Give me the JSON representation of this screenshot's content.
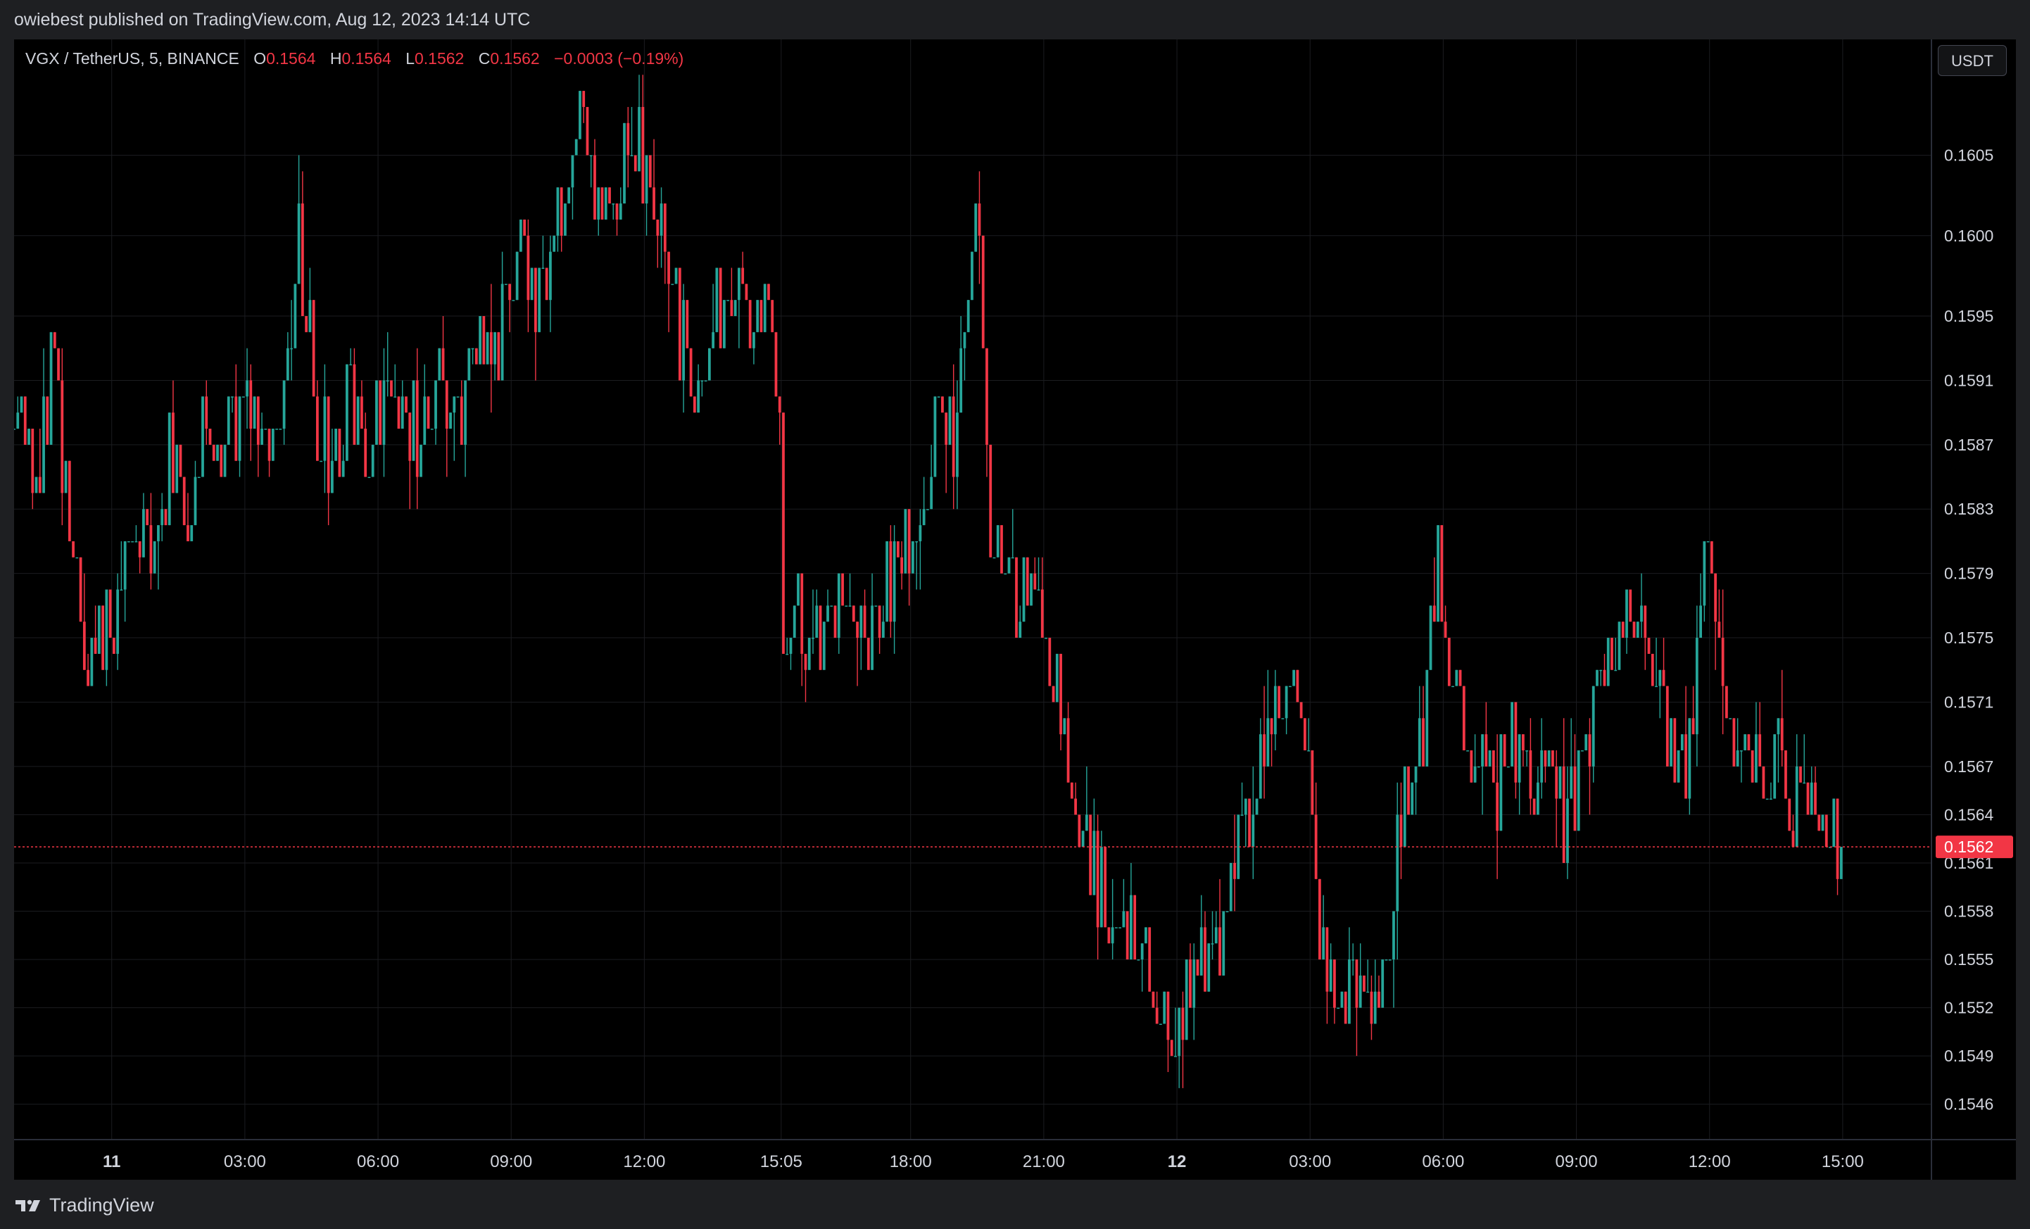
{
  "header": {
    "published": "owiebest published on TradingView.com, Aug 12, 2023 14:14 UTC"
  },
  "symbol": {
    "name": "VGX / TetherUS, 5, BINANCE",
    "o_label": "O",
    "o_value": "0.1564",
    "h_label": "H",
    "h_value": "0.1564",
    "l_label": "L",
    "l_value": "0.1562",
    "c_label": "C",
    "c_value": "0.1562",
    "change": "−0.0003 (−0.19%)"
  },
  "currency_button": "USDT",
  "footer": {
    "brand": "TradingView",
    "logo_icon": "tradingview-logo-icon"
  },
  "colors": {
    "up": "#26a69a",
    "down": "#f23645",
    "price_line": "#f23645",
    "background": "#000000",
    "grid": "#1b1c20"
  },
  "chart_data": {
    "type": "candlestick",
    "title": "",
    "xlabel": "",
    "ylabel": "",
    "ylim": [
      0.15438,
      0.16122
    ],
    "x_ticks": [
      "11",
      "03:00",
      "06:00",
      "09:00",
      "12:00",
      "15:05",
      "18:00",
      "21:00",
      "12",
      "03:00",
      "06:00",
      "09:00",
      "12:00",
      "15:00"
    ],
    "x_tick_hours": [
      0,
      3,
      6,
      9,
      12,
      15.083,
      18,
      21,
      24,
      27,
      30,
      33,
      36,
      39
    ],
    "x_range_hours": [
      -2.2,
      41
    ],
    "y_ticks": [
      "0.1546",
      "0.1549",
      "0.1552",
      "0.1555",
      "0.1558",
      "0.1561",
      "0.1564",
      "0.1567",
      "0.1571",
      "0.1575",
      "0.1579",
      "0.1583",
      "0.1587",
      "0.1591",
      "0.1595",
      "0.1600",
      "0.1605"
    ],
    "last_price": "0.1562",
    "grid": true,
    "path": [
      [
        -2.2,
        0.1588
      ],
      [
        -1.7,
        0.1584
      ],
      [
        -1.3,
        0.1592
      ],
      [
        -0.9,
        0.158
      ],
      [
        -0.5,
        0.1573
      ],
      [
        -0.1,
        0.1577
      ],
      [
        0.3,
        0.1578
      ],
      [
        0.7,
        0.1583
      ],
      [
        1.0,
        0.1581
      ],
      [
        1.3,
        0.1586
      ],
      [
        1.7,
        0.1582
      ],
      [
        2.1,
        0.1589
      ],
      [
        2.5,
        0.1586
      ],
      [
        2.9,
        0.159
      ],
      [
        3.3,
        0.1587
      ],
      [
        3.9,
        0.159
      ],
      [
        4.2,
        0.16
      ],
      [
        4.6,
        0.1589
      ],
      [
        5.0,
        0.1586
      ],
      [
        5.4,
        0.159
      ],
      [
        5.8,
        0.1587
      ],
      [
        6.2,
        0.1591
      ],
      [
        6.6,
        0.1589
      ],
      [
        7.0,
        0.1588
      ],
      [
        7.5,
        0.159
      ],
      [
        7.9,
        0.1589
      ],
      [
        8.3,
        0.1595
      ],
      [
        8.7,
        0.1593
      ],
      [
        9.0,
        0.1596
      ],
      [
        9.3,
        0.1599
      ],
      [
        9.6,
        0.1596
      ],
      [
        9.9,
        0.1601
      ],
      [
        10.2,
        0.1603
      ],
      [
        10.5,
        0.1606
      ],
      [
        10.8,
        0.1604
      ],
      [
        11.1,
        0.1602
      ],
      [
        11.4,
        0.1604
      ],
      [
        11.7,
        0.1607
      ],
      [
        12.0,
        0.1605
      ],
      [
        12.4,
        0.1599
      ],
      [
        12.8,
        0.1594
      ],
      [
        13.2,
        0.1591
      ],
      [
        13.6,
        0.1595
      ],
      [
        13.9,
        0.1594
      ],
      [
        14.2,
        0.1597
      ],
      [
        14.5,
        0.1593
      ],
      [
        14.8,
        0.1595
      ],
      [
        15.05,
        0.1589
      ],
      [
        15.15,
        0.1573
      ],
      [
        15.4,
        0.1577
      ],
      [
        15.8,
        0.1574
      ],
      [
        16.2,
        0.1577
      ],
      [
        16.6,
        0.1575
      ],
      [
        17.0,
        0.1574
      ],
      [
        17.4,
        0.1578
      ],
      [
        17.8,
        0.158
      ],
      [
        18.2,
        0.1583
      ],
      [
        18.6,
        0.1588
      ],
      [
        19.0,
        0.1587
      ],
      [
        19.3,
        0.1596
      ],
      [
        19.55,
        0.1603
      ],
      [
        19.8,
        0.1582
      ],
      [
        20.2,
        0.1578
      ],
      [
        20.6,
        0.1578
      ],
      [
        21.0,
        0.1576
      ],
      [
        21.3,
        0.1573
      ],
      [
        21.6,
        0.1566
      ],
      [
        22.0,
        0.1562
      ],
      [
        22.4,
        0.1558
      ],
      [
        22.8,
        0.1556
      ],
      [
        23.1,
        0.1557
      ],
      [
        23.4,
        0.1554
      ],
      [
        23.8,
        0.155
      ],
      [
        24.2,
        0.1553
      ],
      [
        24.6,
        0.1555
      ],
      [
        25.0,
        0.1557
      ],
      [
        25.4,
        0.1562
      ],
      [
        25.8,
        0.1567
      ],
      [
        26.2,
        0.1572
      ],
      [
        26.6,
        0.1571
      ],
      [
        26.9,
        0.1569
      ],
      [
        27.2,
        0.1558
      ],
      [
        27.6,
        0.1552
      ],
      [
        28.0,
        0.1553
      ],
      [
        28.4,
        0.1552
      ],
      [
        28.7,
        0.1555
      ],
      [
        29.0,
        0.1562
      ],
      [
        29.3,
        0.1567
      ],
      [
        29.6,
        0.157
      ],
      [
        29.9,
        0.158
      ],
      [
        30.2,
        0.1571
      ],
      [
        30.5,
        0.1568
      ],
      [
        30.8,
        0.1569
      ],
      [
        31.2,
        0.1565
      ],
      [
        31.6,
        0.1568
      ],
      [
        32.0,
        0.1566
      ],
      [
        32.4,
        0.1567
      ],
      [
        32.8,
        0.1563
      ],
      [
        33.2,
        0.1566
      ],
      [
        33.6,
        0.1574
      ],
      [
        34.0,
        0.1576
      ],
      [
        34.3,
        0.1576
      ],
      [
        34.6,
        0.1573
      ],
      [
        35.0,
        0.1569
      ],
      [
        35.3,
        0.1568
      ],
      [
        35.6,
        0.1567
      ],
      [
        35.9,
        0.158
      ],
      [
        36.1,
        0.1578
      ],
      [
        36.3,
        0.1572
      ],
      [
        36.6,
        0.1569
      ],
      [
        36.9,
        0.1566
      ],
      [
        37.2,
        0.1567
      ],
      [
        37.5,
        0.1568
      ],
      [
        37.8,
        0.1564
      ],
      [
        38.1,
        0.1566
      ],
      [
        38.4,
        0.1563
      ],
      [
        38.7,
        0.1564
      ],
      [
        39.0,
        0.1562
      ]
    ]
  }
}
